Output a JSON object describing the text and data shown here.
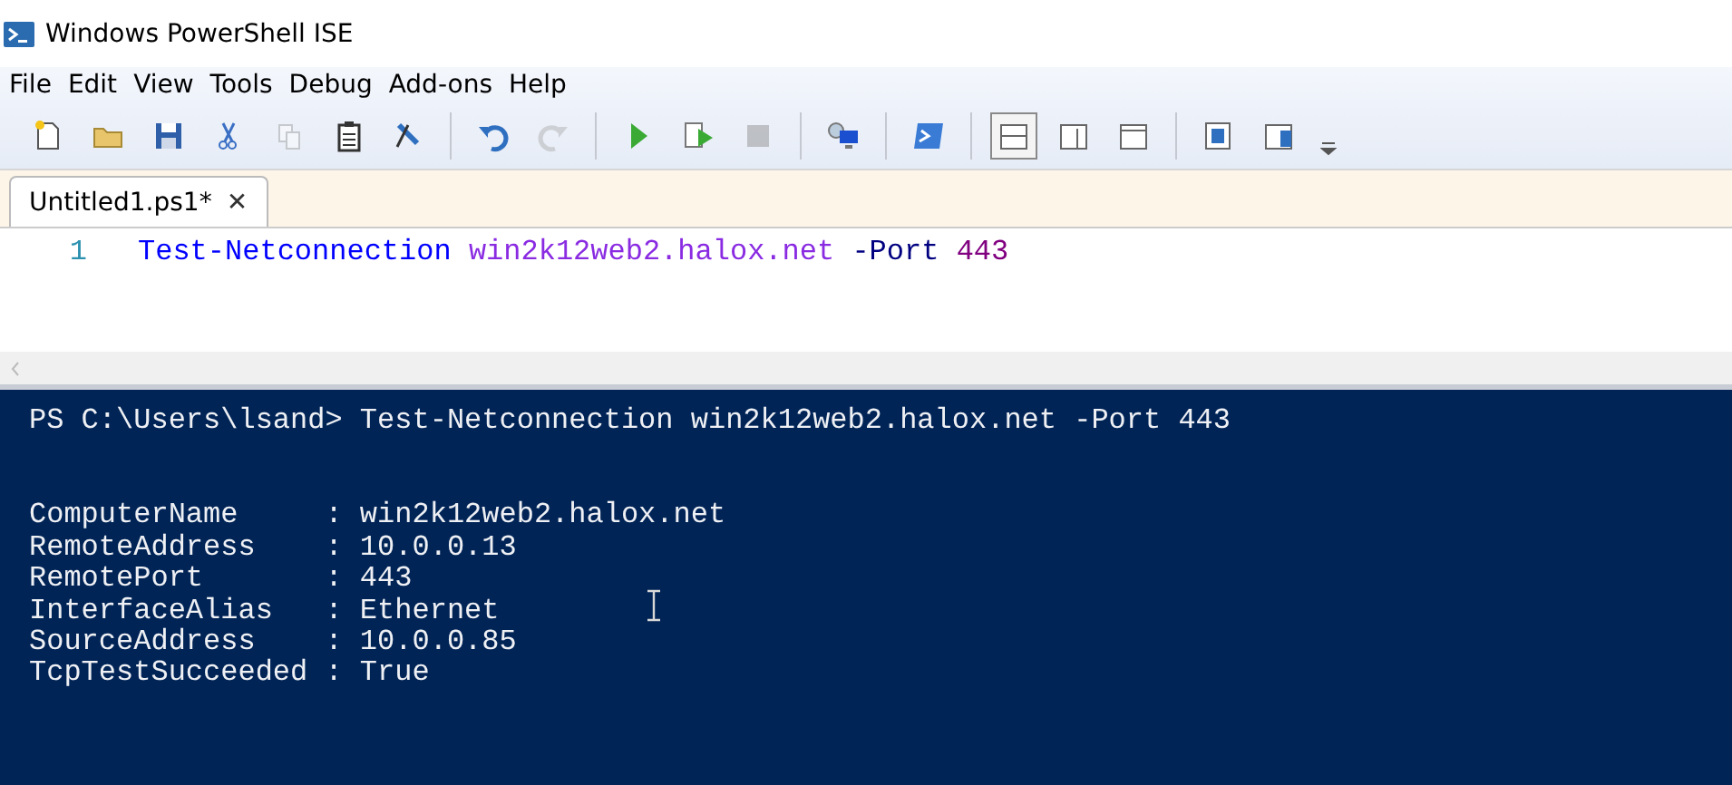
{
  "window": {
    "title": "Windows PowerShell ISE"
  },
  "menu": [
    "File",
    "Edit",
    "View",
    "Tools",
    "Debug",
    "Add-ons",
    "Help"
  ],
  "toolbar": [
    [
      {
        "kind": "new",
        "disabled": false,
        "selected": false
      },
      {
        "kind": "open",
        "disabled": false,
        "selected": false
      },
      {
        "kind": "save",
        "disabled": false,
        "selected": false
      },
      {
        "kind": "cut",
        "disabled": false,
        "selected": false
      },
      {
        "kind": "copy",
        "disabled": true,
        "selected": false
      },
      {
        "kind": "paste",
        "disabled": false,
        "selected": false
      },
      {
        "kind": "clear",
        "disabled": false,
        "selected": false
      }
    ],
    [
      {
        "kind": "undo",
        "disabled": false,
        "selected": false
      },
      {
        "kind": "redo",
        "disabled": true,
        "selected": false
      }
    ],
    [
      {
        "kind": "run",
        "disabled": false,
        "selected": false
      },
      {
        "kind": "runsel",
        "disabled": false,
        "selected": false
      },
      {
        "kind": "stop",
        "disabled": true,
        "selected": false
      }
    ],
    [
      {
        "kind": "remote",
        "disabled": false,
        "selected": false
      }
    ],
    [
      {
        "kind": "shell",
        "disabled": false,
        "selected": false
      }
    ],
    [
      {
        "kind": "paneTop",
        "disabled": false,
        "selected": true
      },
      {
        "kind": "paneRight",
        "disabled": false,
        "selected": false
      },
      {
        "kind": "paneMax",
        "disabled": false,
        "selected": false
      }
    ],
    [
      {
        "kind": "showTop",
        "disabled": false,
        "selected": false
      },
      {
        "kind": "showRight",
        "disabled": false,
        "selected": false
      }
    ]
  ],
  "tabs": [
    {
      "label": "Untitled1.ps1*",
      "selected": true,
      "close": "✕"
    }
  ],
  "editor": {
    "lines": [
      {
        "number": "1",
        "tokens": [
          {
            "kind": "command",
            "text": "Test-Netconnection"
          },
          {
            "kind": "argument",
            "text": "win2k12web2.halox.net"
          },
          {
            "kind": "parameter",
            "text": "-Port"
          },
          {
            "kind": "number",
            "text": "443"
          }
        ]
      }
    ]
  },
  "console": {
    "prompt": "PS C:\\Users\\lsand> Test-Netconnection win2k12web2.halox.net -Port 443",
    "output": [
      "ComputerName     : win2k12web2.halox.net",
      "RemoteAddress    : 10.0.0.13",
      "RemotePort       : 443",
      "InterfaceAlias   : Ethernet",
      "SourceAddress    : 10.0.0.85",
      "TcpTestSucceeded : True"
    ]
  }
}
